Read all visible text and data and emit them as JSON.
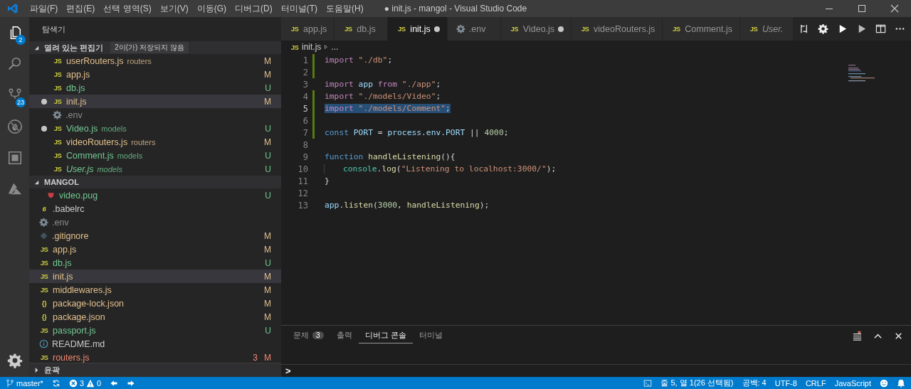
{
  "window": {
    "title": "● init.js - mangol - Visual Studio Code"
  },
  "menu": [
    "파일(F)",
    "편집(E)",
    "선택 영역(S)",
    "보기(V)",
    "이동(G)",
    "디버그(D)",
    "터미널(T)",
    "도움말(H)"
  ],
  "activity_bar": [
    {
      "kind": "files",
      "selected": true,
      "badge": "2"
    },
    {
      "kind": "search",
      "selected": false
    },
    {
      "kind": "scm",
      "selected": false,
      "badge": "23"
    },
    {
      "kind": "debug",
      "selected": false
    },
    {
      "kind": "extensions",
      "selected": false
    },
    {
      "kind": "azure",
      "selected": false
    }
  ],
  "sidebar": {
    "title": "탐색기",
    "open_editors": {
      "title": "열려 있는 편집기",
      "note": "2이(가) 저장되지 않음",
      "items": [
        {
          "kind": "js",
          "type_label": "JS",
          "name": "userRouters.js",
          "folder": "routers",
          "status": "M",
          "dirty": false,
          "selected": false
        },
        {
          "kind": "js",
          "type_label": "JS",
          "name": "app.js",
          "status": "M",
          "dirty": false,
          "selected": false
        },
        {
          "kind": "js",
          "type_label": "JS",
          "name": "db.js",
          "status": "U",
          "dirty": false,
          "selected": false
        },
        {
          "kind": "js",
          "type_label": "JS",
          "name": "init.js",
          "status": "M",
          "dirty": true,
          "selected": true
        },
        {
          "kind": "env",
          "name": ".env",
          "dirty": false,
          "selected": false,
          "ignored": true
        },
        {
          "kind": "js",
          "type_label": "JS",
          "name": "Video.js",
          "folder": "models",
          "status": "U",
          "dirty": true,
          "selected": false
        },
        {
          "kind": "js",
          "type_label": "JS",
          "name": "videoRouters.js",
          "folder": "routers",
          "status": "M",
          "dirty": false,
          "selected": false
        },
        {
          "kind": "js",
          "type_label": "JS",
          "name": "Comment.js",
          "folder": "models",
          "status": "U",
          "dirty": false,
          "selected": false
        },
        {
          "kind": "js",
          "type_label": "JS",
          "name": "User.js",
          "folder": "models",
          "status": "U",
          "dirty": false,
          "selected": false,
          "preview": true
        }
      ]
    },
    "folder": {
      "title": "MANGOL",
      "items": [
        {
          "kind": "pug",
          "name": "video.pug",
          "status": "U",
          "selected": false
        },
        {
          "kind": "babel",
          "type_label": "6",
          "name": ".babelrc",
          "selected": false
        },
        {
          "kind": "env",
          "name": ".env",
          "selected": false,
          "ignored": true
        },
        {
          "kind": "git",
          "name": ".gitignore",
          "status": "M",
          "selected": false
        },
        {
          "kind": "js",
          "type_label": "JS",
          "name": "app.js",
          "status": "M",
          "selected": false
        },
        {
          "kind": "js",
          "type_label": "JS",
          "name": "db.js",
          "status": "U",
          "selected": false
        },
        {
          "kind": "js",
          "type_label": "JS",
          "name": "init.js",
          "status": "M",
          "selected": true
        },
        {
          "kind": "js",
          "type_label": "JS",
          "name": "middlewares.js",
          "status": "M",
          "selected": false
        },
        {
          "kind": "json",
          "type_label": "{}",
          "name": "package-lock.json",
          "status": "M",
          "selected": false
        },
        {
          "kind": "json",
          "type_label": "{}",
          "name": "package.json",
          "status": "M",
          "selected": false
        },
        {
          "kind": "js",
          "type_label": "JS",
          "name": "passport.js",
          "status": "U",
          "selected": false
        },
        {
          "kind": "info",
          "name": "README.md",
          "selected": false
        },
        {
          "kind": "js",
          "type_label": "JS",
          "name": "routers.js",
          "status": "M",
          "problems": "3",
          "selected": false,
          "error": true
        }
      ]
    },
    "outline": {
      "title": "윤곽",
      "expanded": false
    }
  },
  "tabs": [
    {
      "kind": "js",
      "type_label": "JS",
      "name": "app.js",
      "selected": false,
      "dirty": false
    },
    {
      "kind": "js",
      "type_label": "JS",
      "name": "db.js",
      "selected": false,
      "dirty": false
    },
    {
      "kind": "js",
      "type_label": "JS",
      "name": "init.js",
      "selected": true,
      "dirty": true
    },
    {
      "kind": "env",
      "name": ".env",
      "selected": false,
      "dirty": false
    },
    {
      "kind": "js",
      "type_label": "JS",
      "name": "Video.js",
      "selected": false,
      "dirty": true
    },
    {
      "kind": "js",
      "type_label": "JS",
      "name": "videoRouters.js",
      "selected": false,
      "dirty": false
    },
    {
      "kind": "js",
      "type_label": "JS",
      "name": "Comment.js",
      "selected": false,
      "dirty": false
    },
    {
      "kind": "js",
      "type_label": "JS",
      "name": "User.",
      "selected": false,
      "dirty": false,
      "preview": true
    }
  ],
  "breadcrumb": {
    "type_label": "JS",
    "file": "init.js",
    "rest": "..."
  },
  "code": [
    {
      "number": "1",
      "modified": true,
      "selected": false,
      "tokens": [
        {
          "kind": "kw",
          "text": "import "
        },
        {
          "kind": "str",
          "text": "\"./db\""
        },
        {
          "kind": "plain",
          "text": ";"
        }
      ]
    },
    {
      "number": "2",
      "modified": true,
      "selected": false
    },
    {
      "number": "3",
      "modified": false,
      "selected": false,
      "tokens": [
        {
          "kind": "kw",
          "text": "import "
        },
        {
          "kind": "var",
          "text": "app "
        },
        {
          "kind": "kw",
          "text": "from "
        },
        {
          "kind": "str",
          "text": "\"./app\""
        },
        {
          "kind": "plain",
          "text": ";"
        }
      ]
    },
    {
      "number": "4",
      "modified": true,
      "selected": false,
      "tokens": [
        {
          "kind": "kw",
          "text": "import "
        },
        {
          "kind": "str",
          "text": "\"./models/Video\""
        },
        {
          "kind": "plain",
          "text": ";"
        }
      ]
    },
    {
      "number": "5",
      "modified": true,
      "selected": true,
      "tokens": [
        {
          "kind": "kw",
          "text": "import "
        },
        {
          "kind": "str",
          "text": "\"./models/Comment\""
        },
        {
          "kind": "plain",
          "text": ";"
        }
      ]
    },
    {
      "number": "6",
      "modified": true,
      "selected": false
    },
    {
      "number": "7",
      "modified": true,
      "selected": false,
      "tokens": [
        {
          "kind": "storage",
          "text": "const "
        },
        {
          "kind": "const",
          "text": "PORT"
        },
        {
          "kind": "plain",
          "text": " = "
        },
        {
          "kind": "var",
          "text": "process.env.PORT"
        },
        {
          "kind": "plain",
          "text": " || "
        },
        {
          "kind": "num",
          "text": "4000"
        },
        {
          "kind": "plain",
          "text": ";"
        }
      ]
    },
    {
      "number": "8",
      "modified": false,
      "selected": false
    },
    {
      "number": "9",
      "modified": false,
      "selected": false,
      "tokens": [
        {
          "kind": "storage",
          "text": "function "
        },
        {
          "kind": "fn",
          "text": "handleListening"
        },
        {
          "kind": "plain",
          "text": "(){"
        }
      ]
    },
    {
      "number": "10",
      "modified": false,
      "selected": false,
      "indent": true,
      "tokens": [
        {
          "kind": "cls",
          "text": "console"
        },
        {
          "kind": "plain",
          "text": "."
        },
        {
          "kind": "fn",
          "text": "log"
        },
        {
          "kind": "plain",
          "text": "("
        },
        {
          "kind": "str",
          "text": "\"Listening to localhost:3000/\""
        },
        {
          "kind": "plain",
          "text": ");"
        }
      ]
    },
    {
      "number": "11",
      "modified": false,
      "selected": false,
      "tokens": [
        {
          "kind": "plain",
          "text": "}"
        }
      ]
    },
    {
      "number": "12",
      "modified": false,
      "selected": false
    },
    {
      "number": "13",
      "modified": false,
      "selected": false,
      "tokens": [
        {
          "kind": "var",
          "text": "app"
        },
        {
          "kind": "plain",
          "text": "."
        },
        {
          "kind": "fn",
          "text": "listen"
        },
        {
          "kind": "plain",
          "text": "("
        },
        {
          "kind": "num",
          "text": "3000"
        },
        {
          "kind": "plain",
          "text": ", "
        },
        {
          "kind": "fn",
          "text": "handleListening"
        },
        {
          "kind": "plain",
          "text": ");"
        }
      ]
    }
  ],
  "panel": {
    "tabs": [
      {
        "label": "문제",
        "badge": "3",
        "selected": false
      },
      {
        "label": "출력",
        "selected": false
      },
      {
        "label": "디버그 콘솔",
        "selected": true
      },
      {
        "label": "터미널",
        "selected": false
      }
    ],
    "prompt": ">"
  },
  "status_bar": {
    "branch": "master*",
    "errors": "3",
    "warnings": "0",
    "position": "줄 5, 열 1(26 선택됨)",
    "indent": "공백: 4",
    "encoding": "UTF-8",
    "eol": "CRLF",
    "language": "JavaScript"
  }
}
